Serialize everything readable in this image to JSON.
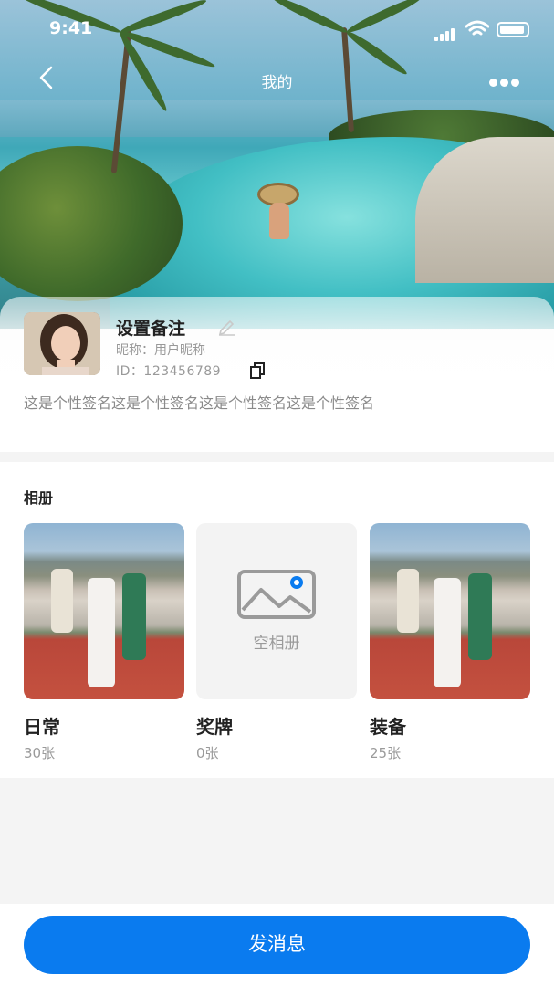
{
  "status_bar": {
    "time": "9:41"
  },
  "nav": {
    "title": "我的"
  },
  "profile": {
    "remark": "设置备注",
    "nickname": "昵称：用户昵称",
    "id_text": "ID：123456789",
    "bio": "这是个性签名这是个性签名这是个性签名这是个性签名"
  },
  "album": {
    "title": "相册",
    "items": [
      {
        "name": "日常",
        "count": "30张"
      },
      {
        "name": "奖牌",
        "count": "0张",
        "empty_label": "空相册"
      },
      {
        "name": "装备",
        "count": "25张"
      }
    ]
  },
  "action": {
    "send_label": "发消息"
  },
  "colors": {
    "primary": "#0a7bef",
    "muted": "#9a9a9a",
    "page_bg": "#f4f4f4"
  }
}
